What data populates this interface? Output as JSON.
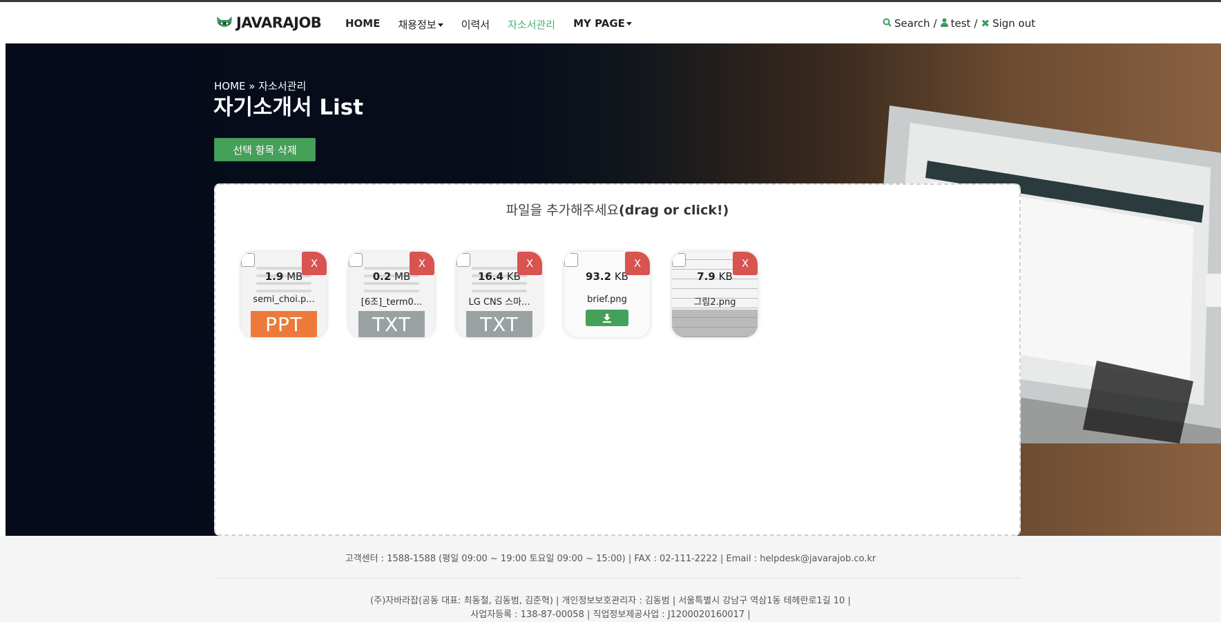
{
  "header": {
    "logo": "JAVARAJOB",
    "nav": [
      {
        "label": "HOME"
      },
      {
        "label": "채용정보"
      },
      {
        "label": "이력서"
      },
      {
        "label": "자소서관리"
      },
      {
        "label": "MY PAGE"
      }
    ],
    "user": {
      "search": "Search",
      "slash1": "/",
      "username": "test",
      "slash2": "/",
      "signout": "Sign out"
    }
  },
  "hero": {
    "breadcrumb": {
      "home": "HOME",
      "separator": "»",
      "current": "자소서관리"
    },
    "title": "자기소개서 List",
    "delete_button": "선택 항목 삭제"
  },
  "dropzone": {
    "message_kr": "파일을 추가해주세요",
    "message_en": "(drag or click!)",
    "files": [
      {
        "size": "1.9",
        "unit": "MB",
        "name": "semi_choi.p...",
        "type": "PPT"
      },
      {
        "size": "0.2",
        "unit": "MB",
        "name": "[6조]_term0...",
        "type": "TXT"
      },
      {
        "size": "16.4",
        "unit": "KB",
        "name": "LG CNS 스마...",
        "type": "TXT"
      },
      {
        "size": "93.2",
        "unit": "KB",
        "name": "brief.png",
        "type": "download"
      },
      {
        "size": "7.9",
        "unit": "KB",
        "name": "그림2.png",
        "type": "image"
      }
    ],
    "remove_label": "X"
  },
  "footer": {
    "line1": "고객센터 : 1588-1588 (평일 09:00 ~ 19:00 토요일 09:00 ~ 15:00) | FAX : 02-111-2222 | Email : helpdesk@javarajob.co.kr",
    "line2": "(주)자바라잡(공동 대표: 최동철, 김동범, 김준혁) | 개인정보보호관리자 : 김동범 | 서울특별시 강남구 역삼1동 테헤란로1길 10 |",
    "line3": "사업자등록 : 138-87-00058 | 직업정보제공사업 : J1200020160017 |"
  },
  "colors": {
    "accent": "#45a05a",
    "active_nav": "#4caf74",
    "remove": "#d9534f",
    "ppt": "#ec7a3a",
    "txt": "#9aa1a2"
  },
  "icons": [
    "raccoon-logo-icon",
    "search-icon",
    "user-icon",
    "close-icon",
    "download-icon",
    "caret-down-icon",
    "double-chevron-icon"
  ]
}
